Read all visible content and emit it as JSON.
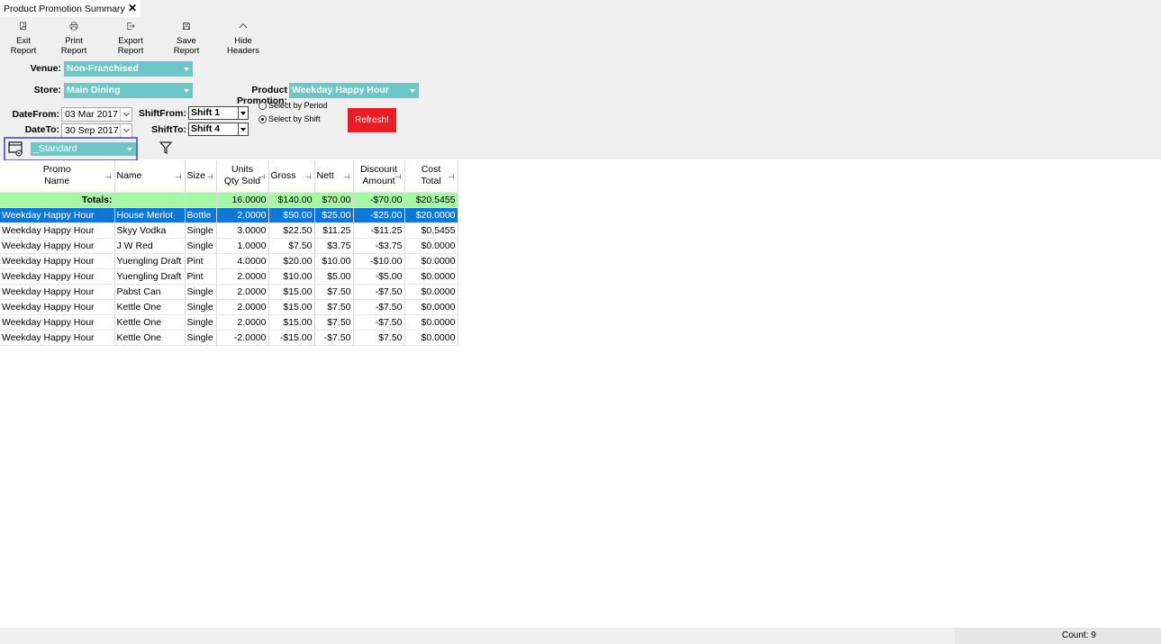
{
  "tab": {
    "title": "Product Promotion Summary",
    "close": "✕"
  },
  "toolbar": {
    "exit": "Exit Report",
    "print": "Print Report",
    "export": "Export Report",
    "save": "Save Report",
    "hide": "Hide Headers"
  },
  "filters": {
    "venue_label": "Venue:",
    "venue_value": "Non-Franchised",
    "store_label": "Store:",
    "store_value": "Main Dining",
    "promo_label": "Product Promotion:",
    "promo_value": "Weekday Happy Hour",
    "datefrom_label": "DateFrom:",
    "datefrom_value": "03 Mar 2017",
    "dateto_label": "DateTo:",
    "dateto_value": "30 Sep 2017",
    "shiftfrom_label": "ShiftFrom:",
    "shiftfrom_value": "Shift 1",
    "shiftto_label": "ShiftTo:",
    "shiftto_value": "Shift 4",
    "radio_period": "Select by Period",
    "radio_shift": "Select by Shift",
    "refresh": "Refresh!",
    "layout_value": "_Standard"
  },
  "grid": {
    "headers": [
      [
        "Promo",
        "Name"
      ],
      [
        "Name"
      ],
      [
        "Size"
      ],
      [
        "Units",
        "Qty Sold"
      ],
      [
        "Gross"
      ],
      [
        "Nett"
      ],
      [
        "Discount",
        "Amount"
      ],
      [
        "Cost",
        "Total"
      ]
    ],
    "totals": [
      "Totals:",
      "",
      "",
      "16.0000",
      "$140.00",
      "$70.00",
      "-$70.00",
      "$20.5455"
    ],
    "rows": [
      [
        "Weekday Happy Hour",
        "House Merlot",
        "Bottle",
        "2.0000",
        "$50.00",
        "$25.00",
        "-$25.00",
        "$20.0000"
      ],
      [
        "Weekday Happy Hour",
        "Skyy Vodka",
        "Single",
        "3.0000",
        "$22.50",
        "$11.25",
        "-$11.25",
        "$0.5455"
      ],
      [
        "Weekday Happy Hour",
        "J W Red",
        "Single",
        "1.0000",
        "$7.50",
        "$3.75",
        "-$3.75",
        "$0.0000"
      ],
      [
        "Weekday Happy Hour",
        "Yuengling Draft",
        "Pint",
        "4.0000",
        "$20.00",
        "$10.00",
        "-$10.00",
        "$0.0000"
      ],
      [
        "Weekday Happy Hour",
        "Yuengling Draft",
        "Pint",
        "2.0000",
        "$10.00",
        "$5.00",
        "-$5.00",
        "$0.0000"
      ],
      [
        "Weekday Happy Hour",
        "Pabst Can",
        "Single",
        "2.0000",
        "$15.00",
        "$7.50",
        "-$7.50",
        "$0.0000"
      ],
      [
        "Weekday Happy Hour",
        "Kettle One",
        "Single",
        "2.0000",
        "$15.00",
        "$7.50",
        "-$7.50",
        "$0.0000"
      ],
      [
        "Weekday Happy Hour",
        "Kettle One",
        "Single",
        "2.0000",
        "$15.00",
        "$7.50",
        "-$7.50",
        "$0.0000"
      ],
      [
        "Weekday Happy Hour",
        "Kettle One",
        "Single",
        "-2.0000",
        "-$15.00",
        "-$7.50",
        "$7.50",
        "$0.0000"
      ]
    ],
    "selected_row": 0
  },
  "status": {
    "count": "Count: 9"
  },
  "colors": {
    "accent": "#6fc6c6",
    "refresh": "#ed1c24",
    "totals": "#a5f7a5",
    "selection": "#0f78d7"
  }
}
